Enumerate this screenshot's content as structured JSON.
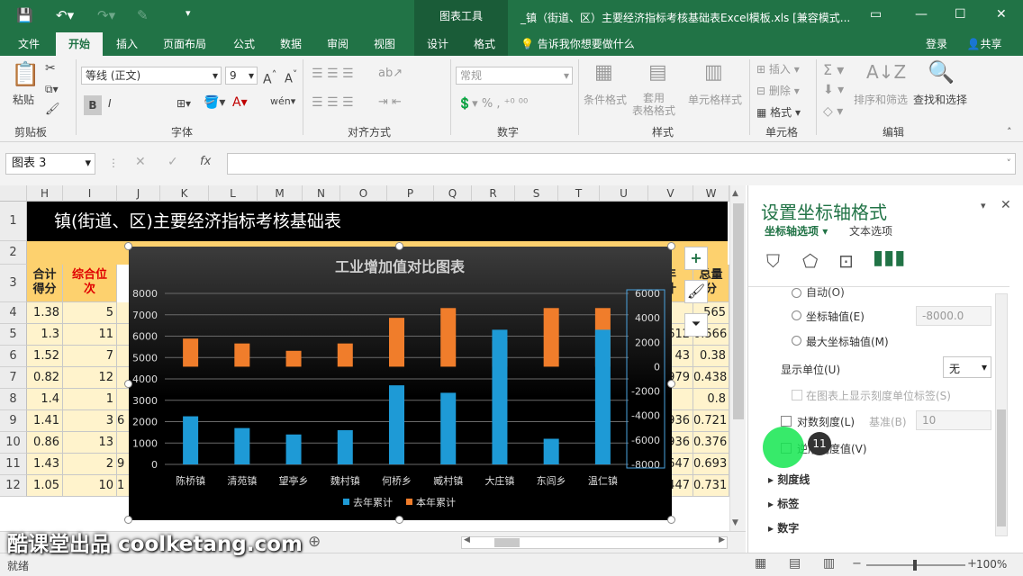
{
  "titlebar": {
    "context_tools": "图表工具",
    "doc_title": "_镇（街道、区）主要经济指标考核基础表Excel模板.xls  [兼容模式..."
  },
  "tabs": [
    "文件",
    "开始",
    "插入",
    "页面布局",
    "公式",
    "数据",
    "审阅",
    "视图",
    "设计",
    "格式"
  ],
  "tell_me": "告诉我你想要做什么",
  "account": {
    "login": "登录",
    "share": "共享"
  },
  "ribbon": {
    "paste": "粘贴",
    "clipboard": "剪贴板",
    "font_name": "等线 (正文)",
    "font_size": "9",
    "font_group": "字体",
    "align_group": "对齐方式",
    "number_format": "常规",
    "number_group": "数字",
    "cond_format": "条件格式",
    "table_format": "套用\n表格格式",
    "cell_style": "单元格样式",
    "style_group": "样式",
    "insert": "插入",
    "delete": "删除",
    "format": "格式",
    "cells_group": "单元格",
    "sort_filter": "排序和筛选",
    "find_select": "查找和选择",
    "edit_group": "编辑"
  },
  "formula": {
    "namebox": "图表 3",
    "fx": "fx"
  },
  "sheet": {
    "columns": [
      "H",
      "I",
      "J",
      "K",
      "L",
      "M",
      "N",
      "O",
      "P",
      "Q",
      "R",
      "S",
      "T",
      "U",
      "V",
      "W"
    ],
    "rows": [
      "1",
      "2",
      "3",
      "4",
      "5",
      "6",
      "7",
      "8",
      "9",
      "10",
      "11",
      "12"
    ],
    "banner": "镇(街道、区)主要经济指标考核基础表",
    "h_header": "合计\n得分",
    "i_header": "综合位\n次",
    "h_values": [
      "1.38",
      "1.3",
      "1.52",
      "0.82",
      "1.4",
      "1.41",
      "0.86",
      "1.43",
      "1.05"
    ],
    "i_values": [
      "5",
      "11",
      "7",
      "12",
      "1",
      "3",
      "13",
      "2",
      "10"
    ],
    "j_partial": [
      "",
      "",
      "",
      "",
      "",
      "6",
      "",
      "9",
      "1"
    ],
    "v_values": [
      "",
      ".612",
      "43",
      "979",
      "",
      "936",
      "936",
      "647",
      "447"
    ],
    "w_values": [
      ".565",
      "0.566",
      "0.38",
      "0.438",
      "0.8",
      "0.721",
      "0.376",
      "0.693",
      "0.731"
    ],
    "v_header": "年\n计",
    "w_header": "总量\n分"
  },
  "chart_data": {
    "type": "bar",
    "title": "工业增加值对比图表",
    "categories": [
      "陈桥镇",
      "清苑镇",
      "望亭乡",
      "魏村镇",
      "何桥乡",
      "臧村镇",
      "大庄镇",
      "东闾乡",
      "温仁镇"
    ],
    "series": [
      {
        "name": "去年累计",
        "axis": "left",
        "values": [
          2250,
          1700,
          1400,
          1600,
          3700,
          3350,
          6300,
          1200,
          6300
        ],
        "color": "#1e9ad6"
      },
      {
        "name": "本年累计",
        "axis": "right",
        "values": [
          2300,
          1900,
          1300,
          1900,
          4000,
          4800,
          2100,
          4800,
          4800
        ],
        "color": "#f07d2b"
      }
    ],
    "left_axis": {
      "min": 0,
      "max": 8000,
      "ticks": [
        "0",
        "1000",
        "2000",
        "3000",
        "4000",
        "5000",
        "6000",
        "7000",
        "8000"
      ]
    },
    "right_axis": {
      "min": -8000,
      "max": 6000,
      "ticks": [
        "-8000",
        "-6000",
        "-4000",
        "-2000",
        "0",
        "2000",
        "4000",
        "6000"
      ]
    },
    "grid": true,
    "legend": "bottom"
  },
  "pane": {
    "title": "设置坐标轴格式",
    "tab_axis": "坐标轴选项",
    "tab_text": "文本选项",
    "auto_label": "自动(O)",
    "axis_value_label": "坐标轴值(E)",
    "axis_value": "-8000.0",
    "max_axis_label": "最大坐标轴值(M)",
    "display_unit_label": "显示单位(U)",
    "display_unit": "无",
    "show_unit_label": "在图表上显示刻度单位标签(S)",
    "log_scale": "对数刻度(L)",
    "base_label": "基准(B)",
    "base_value": "10",
    "reverse": "逆序刻度值(V)",
    "sections": [
      "刻度线",
      "标签",
      "数字"
    ],
    "badge": "11"
  },
  "sheetbar": {
    "add": "⊕"
  },
  "status": {
    "ready": "就绪",
    "zoom": "100%"
  },
  "watermark": "酷课堂出品 coolketang.com"
}
